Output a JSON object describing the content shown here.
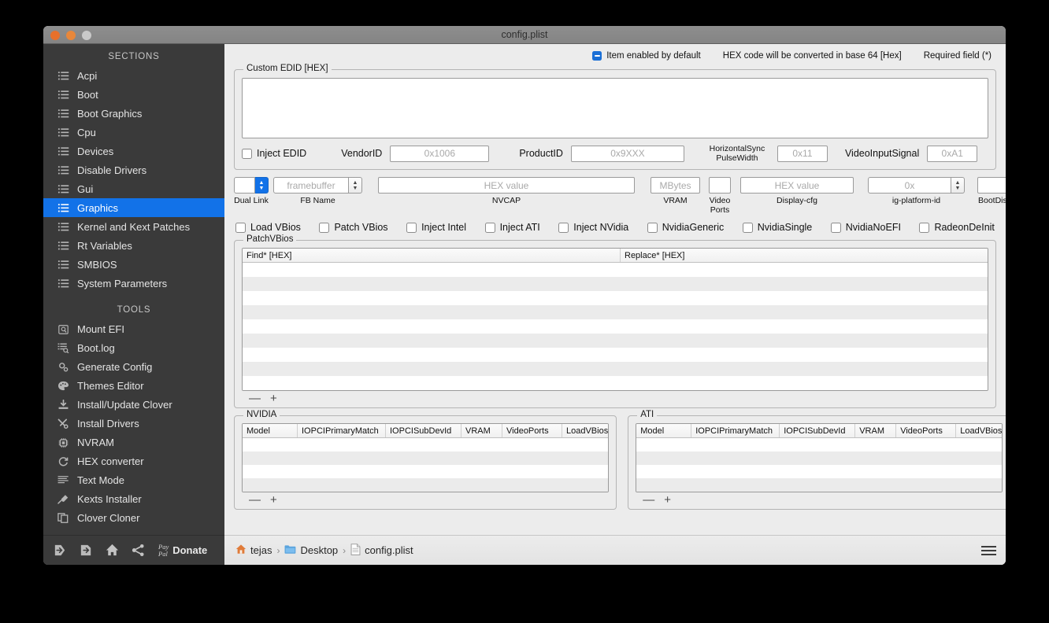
{
  "window": {
    "title": "config.plist",
    "controls": [
      "close",
      "minimize",
      "zoom"
    ]
  },
  "sidebar": {
    "sections_header": "SECTIONS",
    "sections": [
      {
        "label": "Acpi",
        "icon": "list-icon",
        "active": false
      },
      {
        "label": "Boot",
        "icon": "list-icon",
        "active": false
      },
      {
        "label": "Boot Graphics",
        "icon": "list-icon",
        "active": false
      },
      {
        "label": "Cpu",
        "icon": "list-icon",
        "active": false
      },
      {
        "label": "Devices",
        "icon": "list-icon",
        "active": false
      },
      {
        "label": "Disable Drivers",
        "icon": "list-icon",
        "active": false
      },
      {
        "label": "Gui",
        "icon": "list-icon",
        "active": false
      },
      {
        "label": "Graphics",
        "icon": "list-icon",
        "active": true
      },
      {
        "label": "Kernel and Kext Patches",
        "icon": "list-icon",
        "active": false
      },
      {
        "label": "Rt Variables",
        "icon": "list-icon",
        "active": false
      },
      {
        "label": "SMBIOS",
        "icon": "list-icon",
        "active": false
      },
      {
        "label": "System Parameters",
        "icon": "list-icon",
        "active": false
      }
    ],
    "tools_header": "TOOLS",
    "tools": [
      {
        "label": "Mount EFI",
        "icon": "disk-icon"
      },
      {
        "label": "Boot.log",
        "icon": "log-search-icon"
      },
      {
        "label": "Generate Config",
        "icon": "gears-icon"
      },
      {
        "label": "Themes Editor",
        "icon": "palette-icon"
      },
      {
        "label": "Install/Update Clover",
        "icon": "download-icon"
      },
      {
        "label": "Install Drivers",
        "icon": "tools-icon"
      },
      {
        "label": "NVRAM",
        "icon": "chip-icon"
      },
      {
        "label": "HEX converter",
        "icon": "refresh-icon"
      },
      {
        "label": "Text Mode",
        "icon": "text-lines-icon"
      },
      {
        "label": "Kexts Installer",
        "icon": "plug-icon"
      },
      {
        "label": "Clover Cloner",
        "icon": "copy-icon"
      }
    ],
    "toolbar": {
      "icons": [
        {
          "name": "import-icon"
        },
        {
          "name": "export-icon"
        },
        {
          "name": "home-icon"
        },
        {
          "name": "share-icon"
        }
      ],
      "paypal_line1": "Pay",
      "paypal_line2": "Pal",
      "donate_label": "Donate"
    }
  },
  "legend": {
    "enabled_by_default": "Item enabled by default",
    "hex_note": "HEX code will be converted in base 64 [Hex]",
    "required_note": "Required field (*)",
    "accent_color": "#1a6fd6"
  },
  "custom_edid": {
    "title": "Custom EDID [HEX]",
    "textarea_value": "",
    "inject_edid_label": "Inject EDID",
    "inject_edid_checked": false,
    "vendorid_label": "VendorID",
    "vendorid_placeholder": "0x1006",
    "vendorid_value": "",
    "productid_label": "ProductID",
    "productid_placeholder": "0x9XXX",
    "productid_value": "",
    "hsync_label_line1": "HorizontalSync",
    "hsync_label_line2": "PulseWidth",
    "hsync_placeholder": "0x11",
    "hsync_value": "",
    "videoinput_label": "VideoInputSignal",
    "videoinput_placeholder": "0xA1",
    "videoinput_value": ""
  },
  "graphics_row": {
    "dual_link_value": "",
    "dual_link_label": "Dual Link",
    "fb_name_placeholder": "framebuffer",
    "fb_name_value": "",
    "fb_name_label": "FB Name",
    "nvcap_placeholder": "HEX value",
    "nvcap_value": "",
    "nvcap_label": "NVCAP",
    "vram_placeholder": "MBytes",
    "vram_value": "",
    "vram_label": "VRAM",
    "video_ports_value": "",
    "video_ports_label": "Video Ports",
    "display_cfg_placeholder": "HEX value",
    "display_cfg_value": "",
    "display_cfg_label": "Display-cfg",
    "ig_platform_placeholder": "0x",
    "ig_platform_value": "",
    "ig_platform_label": "ig-platform-id",
    "boot_display_value": "",
    "boot_display_label": "BootDisplay"
  },
  "checkbox_row": [
    {
      "label": "Load VBios",
      "checked": false
    },
    {
      "label": "Patch VBios",
      "checked": false
    },
    {
      "label": "Inject Intel",
      "checked": false
    },
    {
      "label": "Inject ATI",
      "checked": false
    },
    {
      "label": "Inject NVidia",
      "checked": false
    },
    {
      "label": "NvidiaGeneric",
      "checked": false
    },
    {
      "label": "NvidiaSingle",
      "checked": false
    },
    {
      "label": "NvidiaNoEFI",
      "checked": false
    },
    {
      "label": "RadeonDeInit",
      "checked": false
    }
  ],
  "patch_vbios": {
    "title": "PatchVBios",
    "columns": [
      "Find* [HEX]",
      "Replace* [HEX]"
    ],
    "rows": [],
    "row_count": 9,
    "remove_label": "—",
    "add_label": "+"
  },
  "nvidia": {
    "title": "NVIDIA",
    "columns": [
      "Model",
      "IOPCIPrimaryMatch",
      "IOPCISubDevId",
      "VRAM",
      "VideoPorts",
      "LoadVBios"
    ],
    "rows": [],
    "row_count": 4,
    "remove_label": "—",
    "add_label": "+"
  },
  "ati": {
    "title": "ATI",
    "columns": [
      "Model",
      "IOPCIPrimaryMatch",
      "IOPCISubDevId",
      "VRAM",
      "VideoPorts",
      "LoadVBios"
    ],
    "rows": [],
    "row_count": 4,
    "remove_label": "—",
    "add_label": "+"
  },
  "statusbar": {
    "breadcrumb": [
      {
        "label": "tejas",
        "icon": "home-folder-icon"
      },
      {
        "label": "Desktop",
        "icon": "folder-icon"
      },
      {
        "label": "config.plist",
        "icon": "file-icon"
      }
    ],
    "separator": "›",
    "menu_icon": "hamburger-icon"
  }
}
